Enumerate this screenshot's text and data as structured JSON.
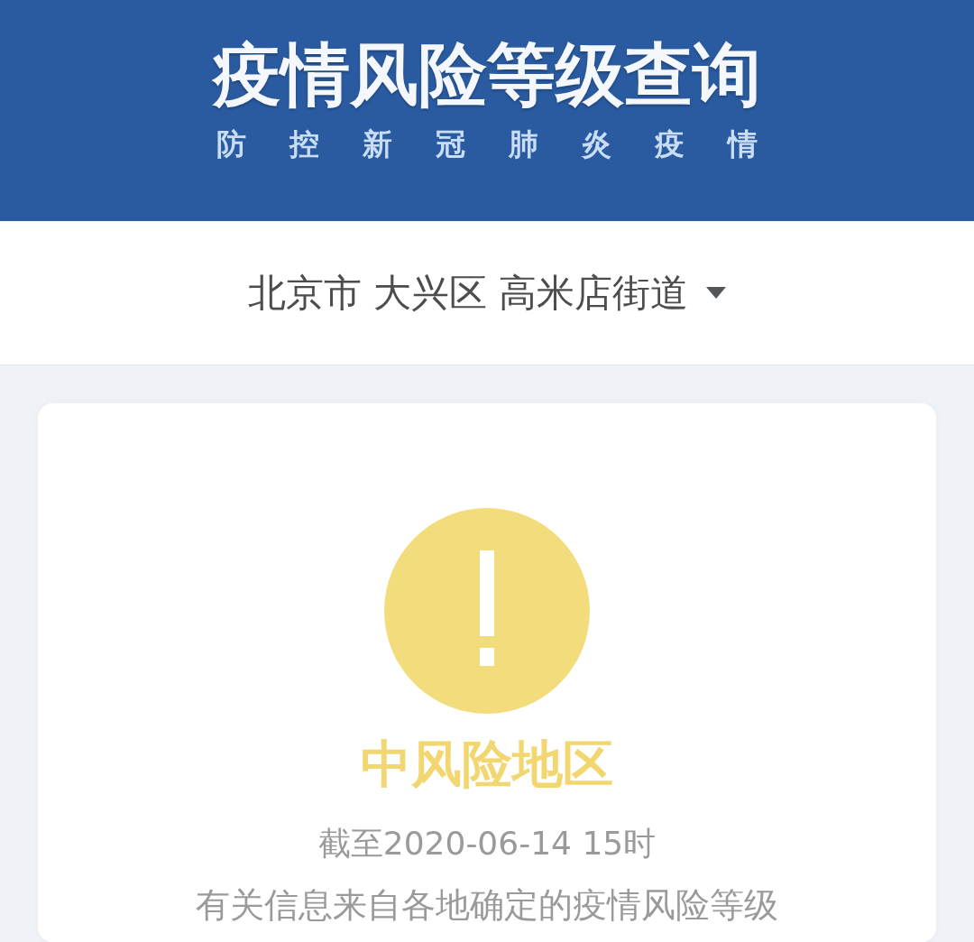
{
  "header": {
    "title": "疫情风险等级查询",
    "subtitle": "防控新冠肺炎疫情"
  },
  "location_selector": {
    "value": "北京市 大兴区 高米店街道"
  },
  "result": {
    "risk_level": "中风险地区",
    "updated": "截至2020-06-14 15时",
    "note": "有关信息来自各地确定的疫情风险等级"
  }
}
